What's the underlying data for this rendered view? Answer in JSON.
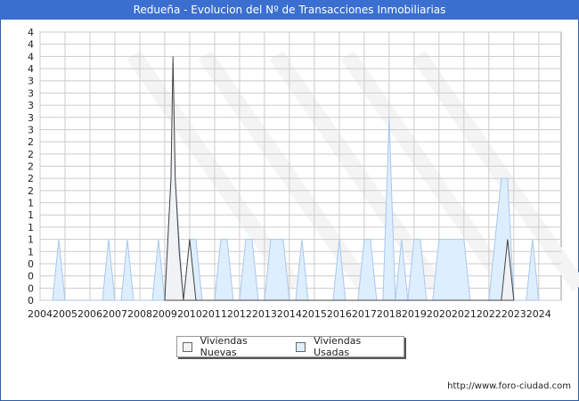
{
  "title": "Redueña - Evolucion del Nº de Transacciones Inmobiliarias",
  "footer_url": "http://www.foro-ciudad.com",
  "legend": {
    "nuevas_label": "Viviendas Nuevas",
    "usadas_label": "Viviendas Usadas"
  },
  "colors": {
    "nuevas_fill": "#f2f2f2",
    "nuevas_line": "#444444",
    "usadas_fill": "#ddeeff",
    "usadas_line": "#a9c7ec",
    "grid": "#cccccc",
    "plot_bg": "#ffffff",
    "title_bg": "#3a6fd0"
  },
  "chart_data": {
    "type": "area",
    "title": "Redueña - Evolucion del Nº de Transacciones Inmobiliarias",
    "x_unit": "year",
    "xlim": [
      2004,
      2024.9
    ],
    "ylim": [
      0,
      4.4
    ],
    "x_tick_labels": [
      "2004",
      "2005",
      "2006",
      "2007",
      "2008",
      "2009",
      "2010",
      "2011",
      "2012",
      "2013",
      "2014",
      "2015",
      "2016",
      "2017",
      "2018",
      "2019",
      "2020",
      "2021",
      "2022",
      "2023",
      "2024"
    ],
    "y_tick_labels": [
      "0",
      "0",
      "0",
      "0",
      "1",
      "1",
      "1",
      "1",
      "1",
      "2",
      "2",
      "2",
      "2",
      "2",
      "3",
      "3",
      "3",
      "3",
      "3",
      "4",
      "4",
      "4",
      "4"
    ],
    "grid": true,
    "legend_position": "bottom",
    "series": [
      {
        "name": "Viviendas Nuevas",
        "points": [
          [
            2009.0,
            0
          ],
          [
            2009.25,
            2
          ],
          [
            2009.33,
            4
          ],
          [
            2009.42,
            2
          ],
          [
            2009.58,
            0.8
          ],
          [
            2009.75,
            0
          ],
          [
            2010.0,
            1
          ],
          [
            2010.25,
            0
          ],
          [
            2022.5,
            0
          ],
          [
            2022.75,
            1
          ],
          [
            2023.0,
            0
          ]
        ]
      },
      {
        "name": "Viviendas Usadas",
        "points": [
          [
            2004.5,
            0
          ],
          [
            2004.75,
            1
          ],
          [
            2005.0,
            0
          ],
          [
            2006.5,
            0
          ],
          [
            2006.75,
            1
          ],
          [
            2007.0,
            0
          ],
          [
            2007.25,
            0
          ],
          [
            2007.5,
            1
          ],
          [
            2007.75,
            0
          ],
          [
            2008.5,
            0
          ],
          [
            2008.75,
            1
          ],
          [
            2009.0,
            0
          ],
          [
            2009.25,
            2
          ],
          [
            2009.33,
            3.7
          ],
          [
            2009.42,
            2
          ],
          [
            2009.58,
            1
          ],
          [
            2009.75,
            0
          ],
          [
            2010.0,
            1
          ],
          [
            2010.25,
            1
          ],
          [
            2010.5,
            0
          ],
          [
            2011.0,
            0
          ],
          [
            2011.25,
            1
          ],
          [
            2011.5,
            1
          ],
          [
            2011.75,
            0
          ],
          [
            2012.0,
            0
          ],
          [
            2012.25,
            1
          ],
          [
            2012.5,
            1
          ],
          [
            2012.75,
            0
          ],
          [
            2013.0,
            0
          ],
          [
            2013.25,
            1
          ],
          [
            2013.75,
            1
          ],
          [
            2014.0,
            0
          ],
          [
            2014.25,
            0
          ],
          [
            2014.5,
            1
          ],
          [
            2014.75,
            0
          ],
          [
            2015.75,
            0
          ],
          [
            2016.0,
            1
          ],
          [
            2016.25,
            0
          ],
          [
            2016.75,
            0
          ],
          [
            2017.0,
            1
          ],
          [
            2017.25,
            1
          ],
          [
            2017.5,
            0
          ],
          [
            2017.75,
            0
          ],
          [
            2017.92,
            2
          ],
          [
            2018.0,
            3
          ],
          [
            2018.08,
            2
          ],
          [
            2018.25,
            0
          ],
          [
            2018.5,
            1
          ],
          [
            2018.75,
            0
          ],
          [
            2019.0,
            1
          ],
          [
            2019.25,
            1
          ],
          [
            2019.5,
            0
          ],
          [
            2019.75,
            0
          ],
          [
            2020.0,
            1
          ],
          [
            2020.5,
            1
          ],
          [
            2020.75,
            1
          ],
          [
            2021.0,
            1
          ],
          [
            2021.25,
            0
          ],
          [
            2022.0,
            0
          ],
          [
            2022.25,
            1
          ],
          [
            2022.5,
            2
          ],
          [
            2022.75,
            2
          ],
          [
            2023.0,
            0
          ],
          [
            2023.5,
            0
          ],
          [
            2023.75,
            1
          ],
          [
            2024.0,
            0
          ]
        ]
      }
    ]
  }
}
